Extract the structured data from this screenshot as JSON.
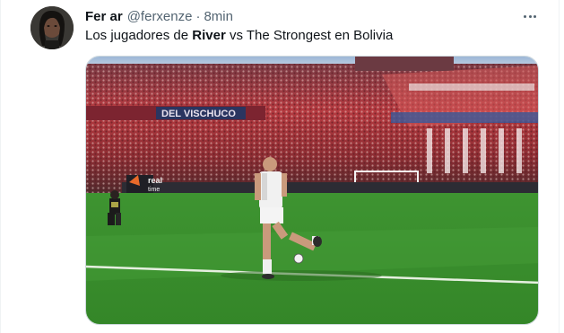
{
  "tweet": {
    "display_name": "Fer ar",
    "handle": "@ferxenze",
    "separator": "·",
    "time": "8min",
    "text_part1": "Los jugadores de ",
    "text_bold": "River",
    "text_part2": " vs The Strongest en Bolivia",
    "more_icon": "more-horizontal-icon"
  },
  "media": {
    "banner_text": "DEL VISCHUCO",
    "ad_text_top": "real",
    "ad_text_bottom": "time"
  },
  "colors": {
    "grass": "#3a8f2c",
    "grass_light": "#4da038",
    "stands_red": "#b8343a",
    "handle_gray": "#536471"
  }
}
